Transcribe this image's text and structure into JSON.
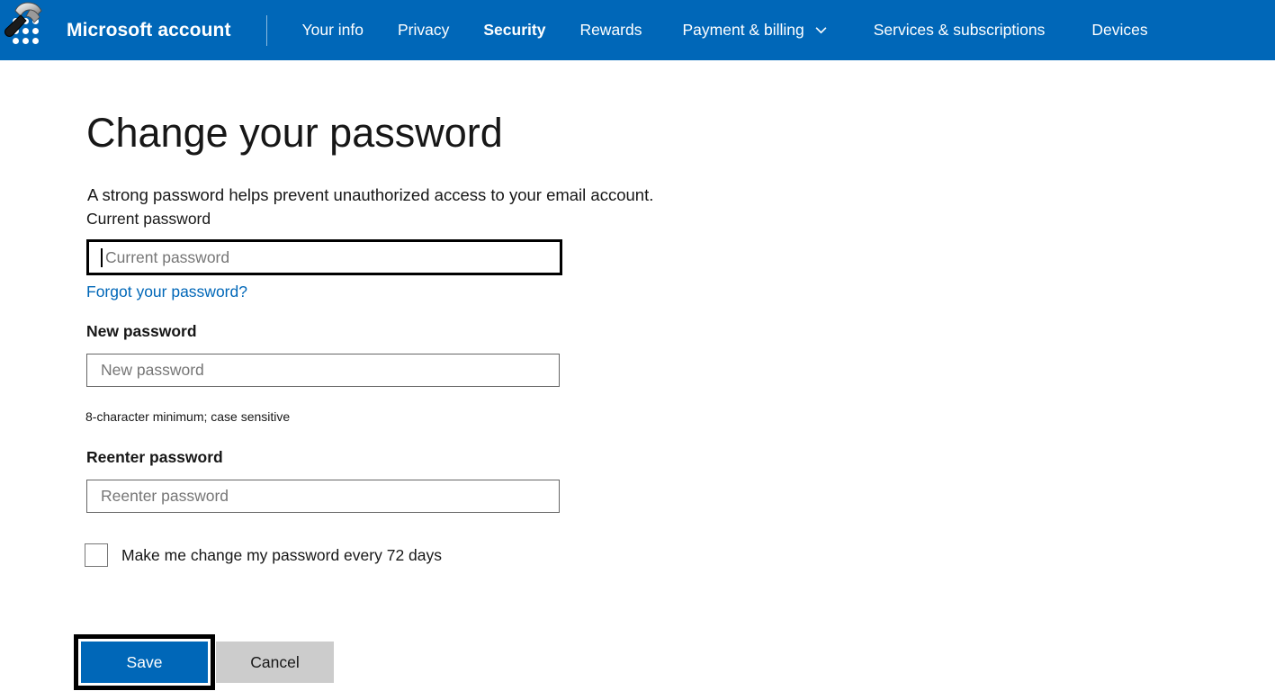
{
  "header": {
    "logo_icon": "waffle-grid-icon",
    "cursor_icon": "hammer-icon",
    "brand": "Microsoft account",
    "nav": [
      {
        "label": "Your info",
        "active": false,
        "has_chevron": false
      },
      {
        "label": "Privacy",
        "active": false,
        "has_chevron": false
      },
      {
        "label": "Security",
        "active": true,
        "has_chevron": false
      },
      {
        "label": "Rewards",
        "active": false,
        "has_chevron": false
      },
      {
        "label": "Payment & billing",
        "active": false,
        "has_chevron": true
      },
      {
        "label": "Services & subscriptions",
        "active": false,
        "has_chevron": false
      },
      {
        "label": "Devices",
        "active": false,
        "has_chevron": false
      }
    ]
  },
  "page": {
    "title": "Change your password",
    "intro": "A strong password helps prevent unauthorized access to your email account."
  },
  "form": {
    "current_password": {
      "label": "Current password",
      "placeholder": "Current password",
      "value": "",
      "focused": true
    },
    "forgot_link": "Forgot your password?",
    "new_password": {
      "label": "New password",
      "placeholder": "New password",
      "value": "",
      "hint": "8-character minimum; case sensitive"
    },
    "reenter_password": {
      "label": "Reenter password",
      "placeholder": "Reenter password",
      "value": ""
    },
    "expiry_checkbox": {
      "label": "Make me change my password every 72 days",
      "checked": false
    }
  },
  "actions": {
    "save_label": "Save",
    "cancel_label": "Cancel"
  },
  "colors": {
    "brand_blue": "#0067b8",
    "link_blue": "#0067b8",
    "cancel_gray": "#cccccc",
    "focus_black": "#000000",
    "placeholder_gray": "#767676"
  }
}
